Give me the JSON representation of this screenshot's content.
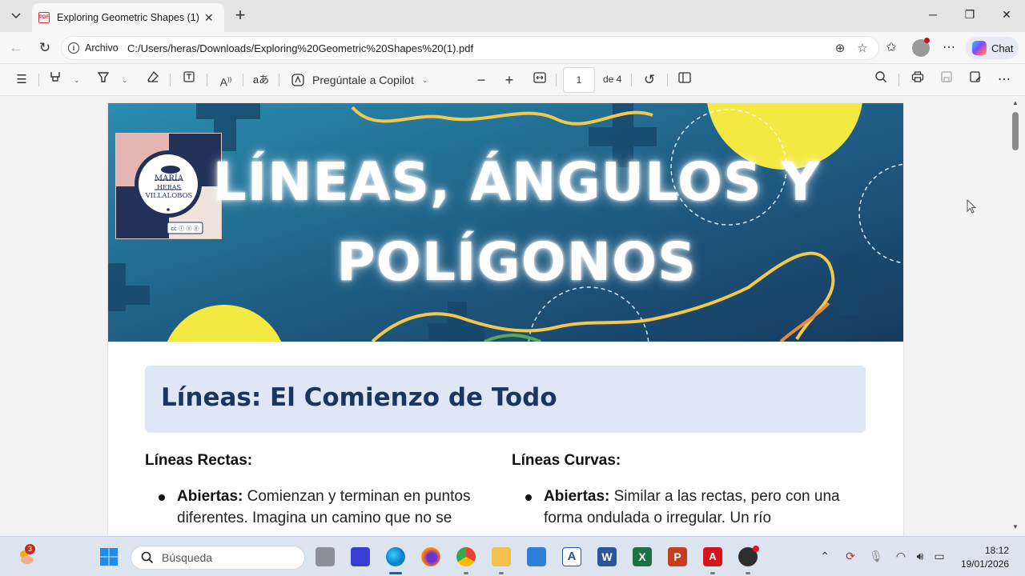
{
  "browser": {
    "tab": {
      "title": "Exploring Geometric Shapes (1).pdf",
      "favicon": "pdf-icon"
    },
    "address": {
      "scheme_label": "Archivo",
      "url": "C:/Users/heras/Downloads/Exploring%20Geometric%20Shapes%20(1).pdf"
    },
    "chat_label": "Chat"
  },
  "pdf_toolbar": {
    "copilot_label": "Pregúntale a Copilot",
    "page_current": "1",
    "page_total_label": "de 4"
  },
  "document": {
    "banner": {
      "title_line1": "LÍNEAS, ÁNGULOS Y",
      "title_line2": "POLÍGONOS",
      "logo": {
        "line1": "MARÍA",
        "line2": "HERAS",
        "line3": "VILLALOBOS"
      },
      "colors": {
        "teal_dark": "#173a5e",
        "teal": "#1f6f8b",
        "yellow": "#f4e842",
        "wave": "#f2c94c"
      }
    },
    "section_title": "Líneas: El Comienzo de Todo",
    "left_column": {
      "heading": "Líneas Rectas:",
      "bullet_term": "Abiertas:",
      "bullet_line1": " Comienzan y terminan en puntos",
      "bullet_line2": "diferentes. Imagina un camino que no se"
    },
    "right_column": {
      "heading": "Líneas Curvas:",
      "bullet_term": "Abiertas:",
      "bullet_line1": " Similar a las rectas, pero con una",
      "bullet_line2": "forma ondulada o irregular. Un río"
    }
  },
  "taskbar": {
    "search_placeholder": "Búsqueda",
    "widgets_badge": "3",
    "time": "18:12",
    "date": "19/01/2026"
  }
}
